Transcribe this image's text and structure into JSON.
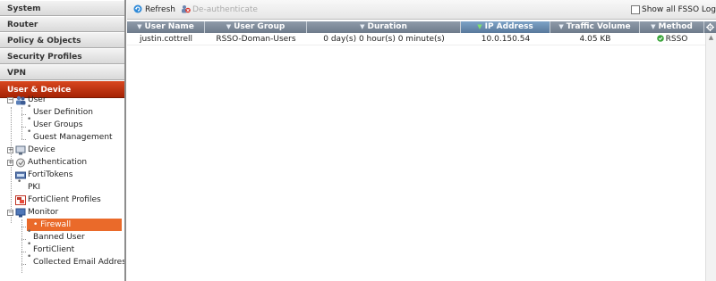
{
  "nav": {
    "categories": [
      "System",
      "Router",
      "Policy & Objects",
      "Security Profiles",
      "VPN"
    ],
    "active_category": "User & Device",
    "tree": {
      "user": "User",
      "user_definition": "User Definition",
      "user_groups": "User Groups",
      "guest_management": "Guest Management",
      "device": "Device",
      "authentication": "Authentication",
      "fortitokens": "FortiTokens",
      "pki": "PKI",
      "forticlient_profiles": "FortiClient Profiles",
      "monitor": "Monitor",
      "firewall": "Firewall",
      "banned_user": "Banned User",
      "forticlient": "FortiClient",
      "collected_email": "Collected Email Addresses"
    }
  },
  "toolbar": {
    "refresh_label": "Refresh",
    "deauth_label": "De-authenticate",
    "show_all_label": "Show all FSSO Logons"
  },
  "grid": {
    "columns": [
      "User Name",
      "User Group",
      "Duration",
      "IP Address",
      "Traffic Volume",
      "Method"
    ],
    "sorted_column": "IP Address",
    "rows": [
      {
        "user_name": "justin.cottrell",
        "user_group": "RSSO-Doman-Users",
        "duration": "0 day(s) 0 hour(s) 0 minute(s)",
        "ip_address": "10.0.150.54",
        "traffic_volume": "4.05 KB",
        "method": "RSSO"
      }
    ]
  },
  "colors": {
    "active_category": "#b8300d",
    "selected_item": "#ea6a2a",
    "header_bg": "#7d8999",
    "method_icon": "#3aa53a"
  },
  "icons": [
    "refresh-icon",
    "deauthenticate-icon",
    "filter-icon",
    "settings-icon",
    "check-shield-icon"
  ]
}
